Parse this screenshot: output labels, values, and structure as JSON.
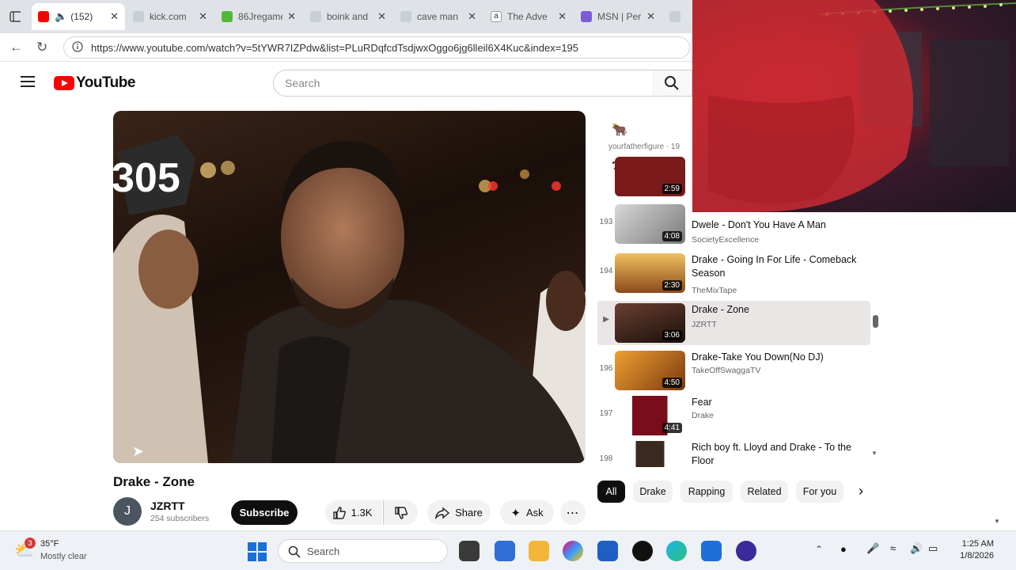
{
  "browser": {
    "tabs": [
      {
        "label": "(152)",
        "active": true,
        "fav_color": "#ff0000"
      },
      {
        "label": "kick.com",
        "fav_color": "#9aa3ad"
      },
      {
        "label": "86Jregame",
        "fav_color": "#53b83a"
      },
      {
        "label": "boink and",
        "fav_color": "#9aa3ad"
      },
      {
        "label": "cave man",
        "fav_color": "#9aa3ad"
      },
      {
        "label": "The Adve",
        "fav_color": "#444444"
      },
      {
        "label": "MSN | Per",
        "fav_color": "#7b5cd6"
      }
    ],
    "url": "https://www.youtube.com/watch?v=5tYWR7IZPdw&list=PLuRDqfcdTsdjwxOggo6jg6lleil6X4Kuc&index=195"
  },
  "youtube": {
    "logo_text": "YouTube",
    "search_placeholder": "Search",
    "video": {
      "title": "Drake - Zone",
      "overlay_badge": "305",
      "channel": "JZRTT",
      "channel_initial": "J",
      "subscribers": "254 subscribers",
      "subscribe_label": "Subscribe",
      "likes": "1.3K",
      "share_label": "Share",
      "ask_label": "Ask"
    },
    "playlist": {
      "owner": "yourfatherfigure · 19",
      "items": [
        {
          "index": "",
          "title": "",
          "channel": "",
          "duration": "2:59",
          "thumb": "#7a1a1a"
        },
        {
          "index": "193",
          "title": "Dwele - Don't You Have A Man",
          "channel": "SocietyExcellence",
          "duration": "4:08",
          "thumb": "#9a9a9a"
        },
        {
          "index": "194",
          "title": "Drake - Going In For Life - Comeback Season",
          "channel": "TheMixTape",
          "duration": "2:30",
          "thumb": "#c08a2a"
        },
        {
          "index": "▶",
          "title": "Drake - Zone",
          "channel": "JZRTT",
          "duration": "3:06",
          "thumb": "#3a2418",
          "active": true
        },
        {
          "index": "196",
          "title": "Drake-Take You Down(No DJ)",
          "channel": "TakeOffSwaggaTV",
          "duration": "4:50",
          "thumb": "#d0761a"
        },
        {
          "index": "197",
          "title": "Fear",
          "channel": "Drake",
          "duration": "4:41",
          "thumb": "#7a0d1a"
        },
        {
          "index": "198",
          "title": "Rich boy ft. Lloyd and Drake - To the Floor",
          "channel": "",
          "duration": "",
          "thumb": "#ddd"
        }
      ]
    },
    "chips": [
      "All",
      "Drake",
      "Rapping",
      "Related",
      "For you"
    ]
  },
  "taskbar": {
    "weather_temp": "35°F",
    "weather_desc": "Mostly clear",
    "weather_badge": "3",
    "search_label": "Search",
    "time": "1:25 AM",
    "date": "1/8/2026"
  }
}
